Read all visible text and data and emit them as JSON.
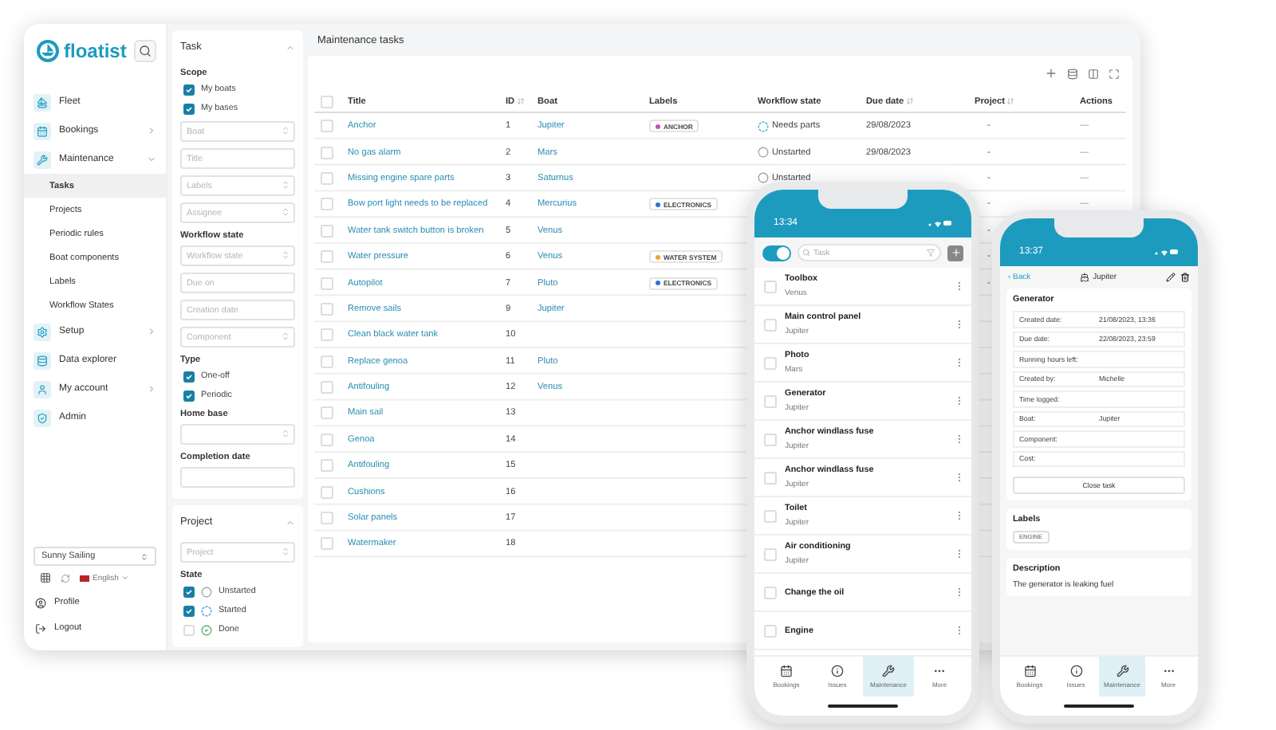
{
  "sidebar": {
    "logo": "floatist",
    "nav": [
      {
        "label": "Fleet",
        "kind": "plain"
      },
      {
        "label": "Bookings",
        "kind": "collapsed"
      },
      {
        "label": "Maintenance",
        "kind": "expanded",
        "children": [
          {
            "label": "Tasks",
            "selected": true
          },
          {
            "label": "Projects",
            "selected": false
          },
          {
            "label": "Periodic rules",
            "selected": false
          },
          {
            "label": "Boat components",
            "selected": false
          },
          {
            "label": "Labels",
            "selected": false
          },
          {
            "label": "Workflow States",
            "selected": false
          }
        ]
      },
      {
        "label": "Setup",
        "kind": "collapsed"
      },
      {
        "label": "Data explorer",
        "kind": "plain"
      },
      {
        "label": "My account",
        "kind": "collapsed"
      },
      {
        "label": "Admin",
        "kind": "plain"
      }
    ],
    "company": "Sunny Sailing",
    "language": "English",
    "footer": [
      "Profile",
      "Logout"
    ]
  },
  "filter_panels": [
    {
      "title": "Task",
      "items": [
        {
          "kind": "heading",
          "text": "Scope"
        },
        {
          "kind": "checkbox",
          "text": "My boats",
          "checked": true
        },
        {
          "kind": "checkbox",
          "text": "My bases",
          "checked": true
        },
        {
          "kind": "select",
          "placeholder": "Boat"
        },
        {
          "kind": "input",
          "placeholder": "Title"
        },
        {
          "kind": "select",
          "placeholder": "Labels"
        },
        {
          "kind": "select",
          "placeholder": "Assignee"
        },
        {
          "kind": "heading",
          "text": "Workflow state"
        },
        {
          "kind": "select",
          "placeholder": "Workflow state"
        },
        {
          "kind": "input",
          "placeholder": "Due on"
        },
        {
          "kind": "input",
          "placeholder": "Creation date"
        },
        {
          "kind": "select",
          "placeholder": "Component"
        },
        {
          "kind": "heading",
          "text": "Type"
        },
        {
          "kind": "checkbox",
          "text": "One-off",
          "checked": true
        },
        {
          "kind": "checkbox",
          "text": "Periodic",
          "checked": true
        },
        {
          "kind": "heading",
          "text": "Home base"
        },
        {
          "kind": "select"
        },
        {
          "kind": "heading",
          "text": "Completion date"
        },
        {
          "kind": "input"
        }
      ]
    },
    {
      "title": "Project",
      "items": [
        {
          "kind": "select",
          "placeholder": "Project"
        },
        {
          "kind": "heading",
          "text": "State"
        },
        {
          "kind": "checkbox",
          "text": "Unstarted",
          "checked": true,
          "icon": {
            "kind": "unstarted"
          }
        },
        {
          "kind": "checkbox",
          "text": "Started",
          "checked": true,
          "icon": {
            "kind": "started"
          }
        },
        {
          "kind": "checkbox",
          "text": "Done",
          "checked": false,
          "icon": {
            "kind": "done"
          }
        }
      ]
    }
  ],
  "main": {
    "title": "Maintenance tasks",
    "all_selected": false,
    "columns": [
      "Title",
      "ID",
      "Boat",
      "Labels",
      "Workflow state",
      "Due date",
      "Project",
      "Actions"
    ],
    "rows": [
      {
        "selected": false,
        "title": "Anchor",
        "id": "1",
        "boat": "Jupiter",
        "label": {
          "text": "ANCHOR",
          "color": "#c653b8"
        },
        "state": {
          "text": "Needs parts",
          "kind": "progress"
        },
        "due": "29/08/2023",
        "project": "-",
        "actions": "—"
      },
      {
        "selected": false,
        "title": "No gas alarm",
        "id": "2",
        "boat": "Mars",
        "state": {
          "text": "Unstarted",
          "kind": "unstarted"
        },
        "due": "29/08/2023",
        "project": "-",
        "actions": "—"
      },
      {
        "selected": false,
        "title": "Missing engine spare parts",
        "id": "3",
        "boat": "Saturnus",
        "state": {
          "text": "Unstarted",
          "kind": "unstarted"
        },
        "project": "-",
        "actions": "—"
      },
      {
        "selected": false,
        "title": "Bow port light needs to be replaced",
        "id": "4",
        "boat": "Mercurius",
        "label": {
          "text": "ELECTRONICS",
          "color": "#2f6fd6"
        },
        "project": "-",
        "actions": "—"
      },
      {
        "selected": false,
        "title": "Water tank switch button is broken",
        "id": "5",
        "boat": "Venus",
        "project": "-"
      },
      {
        "selected": false,
        "title": "Water pressure",
        "id": "6",
        "boat": "Venus",
        "label": {
          "text": "WATER SYSTEM",
          "color": "#f0a23a"
        },
        "project": "-"
      },
      {
        "selected": false,
        "title": "Autopilot",
        "id": "7",
        "boat": "Pluto",
        "label": {
          "text": "ELECTRONICS",
          "color": "#2f6fd6"
        },
        "project": "-"
      },
      {
        "selected": false,
        "title": "Remove sails",
        "id": "9",
        "boat": "Jupiter"
      },
      {
        "selected": false,
        "title": "Clean black water tank",
        "id": "10"
      },
      {
        "selected": false,
        "title": "Replace genoa",
        "id": "11",
        "boat": "Pluto"
      },
      {
        "selected": false,
        "title": "Antifouling",
        "id": "12",
        "boat": "Venus"
      },
      {
        "selected": false,
        "title": "Main sail",
        "id": "13"
      },
      {
        "selected": false,
        "title": "Genoa",
        "id": "14"
      },
      {
        "selected": false,
        "title": "Antifouling",
        "id": "15"
      },
      {
        "selected": false,
        "title": "Cushions",
        "id": "16"
      },
      {
        "selected": false,
        "title": "Solar panels",
        "id": "17"
      },
      {
        "selected": false,
        "title": "Watermaker",
        "id": "18"
      }
    ]
  },
  "phone_list": {
    "time": "13:34",
    "toggle_on": true,
    "search": {
      "placeholder": "Task"
    },
    "items": [
      {
        "title": "Toolbox",
        "sub": "Venus",
        "checked": false
      },
      {
        "title": "Main control panel",
        "sub": "Jupiter",
        "checked": false
      },
      {
        "title": "Photo",
        "sub": "Mars",
        "checked": false
      },
      {
        "title": "Generator",
        "sub": "Jupiter",
        "checked": false
      },
      {
        "title": "Anchor windlass fuse",
        "sub": "Jupiter",
        "checked": false
      },
      {
        "title": "Anchor windlass fuse",
        "sub": "Jupiter",
        "checked": false
      },
      {
        "title": "Toilet",
        "sub": "Jupiter",
        "checked": false
      },
      {
        "title": "Air conditioning",
        "sub": "Jupiter",
        "checked": false
      },
      {
        "title": "Change the oil",
        "checked": false
      },
      {
        "title": "Engine",
        "checked": false
      }
    ],
    "tabs": [
      {
        "label": "Bookings",
        "selected": false
      },
      {
        "label": "Issues",
        "selected": false
      },
      {
        "label": "Maintenance",
        "selected": true
      },
      {
        "label": "More",
        "selected": false
      }
    ]
  },
  "phone_detail": {
    "time": "13:37",
    "back": "‹ Back",
    "boat": "Jupiter",
    "task": "Generator",
    "fields": [
      {
        "label": "Created date:",
        "value": "21/08/2023, 13:36"
      },
      {
        "label": "Due date:",
        "value": "22/08/2023, 23:59"
      },
      {
        "label": "Running hours left:"
      },
      {
        "label": "Created by:",
        "value": "Michelle"
      },
      {
        "label": "Time logged:"
      },
      {
        "label": "Boat:",
        "value": "Jupiter"
      },
      {
        "label": "Component:"
      },
      {
        "label": "Cost:"
      }
    ],
    "close_button": "Close task",
    "labels_title": "Labels",
    "label_chip": "ENGINE",
    "description_title": "Description",
    "description": "The generator is leaking fuel",
    "tabs": [
      {
        "label": "Bookings",
        "selected": false
      },
      {
        "label": "Issues",
        "selected": false
      },
      {
        "label": "Maintenance",
        "selected": true
      },
      {
        "label": "More",
        "selected": false
      }
    ]
  }
}
